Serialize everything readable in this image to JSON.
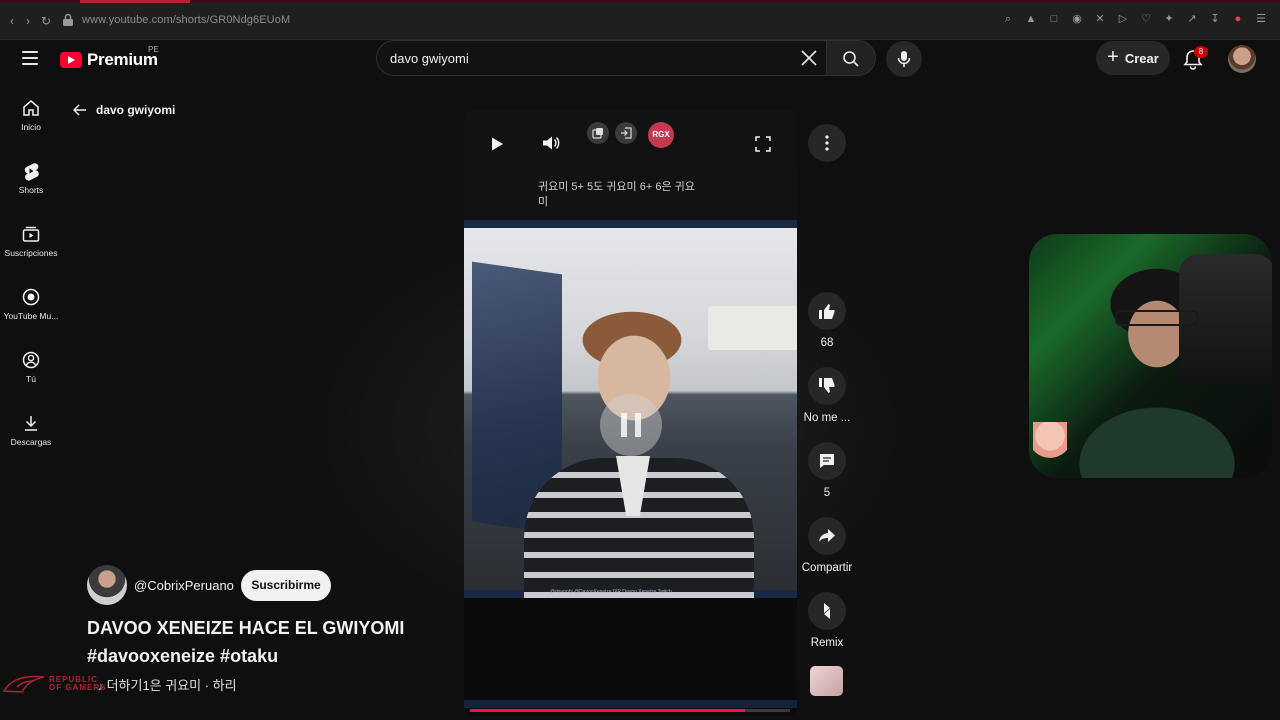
{
  "browser": {
    "url": "www.youtube.com/shorts/GR0Ndg6EUoM"
  },
  "header": {
    "logo_text": "Premium",
    "region": "PE",
    "search_value": "davo gwiyomi",
    "create_label": "Crear",
    "notification_count": "8"
  },
  "sidebar": {
    "items": [
      {
        "label": "Inicio",
        "icon": "home-icon"
      },
      {
        "label": "Shorts",
        "icon": "shorts-icon"
      },
      {
        "label": "Suscripciones",
        "icon": "subscriptions-icon"
      },
      {
        "label": "YouTube Mu...",
        "icon": "youtube-music-icon"
      },
      {
        "label": "Tú",
        "icon": "you-icon"
      },
      {
        "label": "Descargas",
        "icon": "download-icon"
      }
    ]
  },
  "page": {
    "back_title": "davo gwiyomi"
  },
  "player": {
    "rgx_badge": "RGX",
    "caption": "귀요미 5+ 5도 귀요미 6+ 6은 귀요미",
    "strip_socials": "@davoobj   @DavooXeneizeJXR   Davoo Xeneize Twitch",
    "progress": 0.86
  },
  "actions": {
    "like_count": "68",
    "dislike_label": "No me ...",
    "comment_count": "5",
    "share_label": "Compartir",
    "remix_label": "Remix"
  },
  "channel": {
    "name": "@CobrixPeruano",
    "subscribe_label": "Suscribirme",
    "title": "DAVOO XENEIZE HACE EL GWIYOMI #davooxeneize #otaku",
    "sound": "더하기1은 귀요미 · 하리"
  },
  "overlay": {
    "rog_text": "REPUBLIC OF GAMERS"
  },
  "colors": {
    "accent": "#ff0033",
    "progress": "#f0144b",
    "background": "#0f0f0f",
    "chip": "#272727"
  }
}
